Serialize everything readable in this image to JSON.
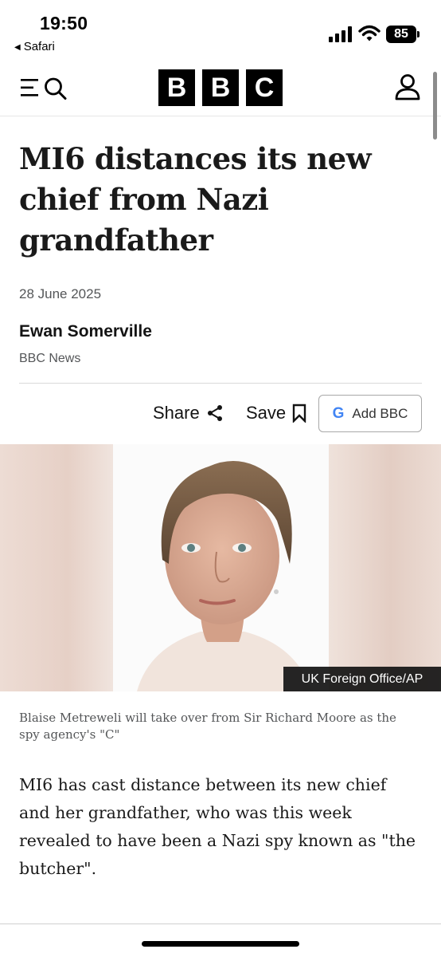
{
  "status_bar": {
    "time": "19:50",
    "back_app": "Safari",
    "battery": "85",
    "icons": [
      "cellular-signal-icon",
      "wifi-icon",
      "battery-icon"
    ]
  },
  "header": {
    "logo_letters": [
      "B",
      "B",
      "C"
    ],
    "icons": [
      "menu-icon",
      "search-icon",
      "account-icon"
    ]
  },
  "article": {
    "headline": "MI6 distances its new chief from Nazi grandfather",
    "date": "28 June 2025",
    "author": "Ewan Somerville",
    "publisher": "BBC News",
    "actions": {
      "share_label": "Share",
      "save_label": "Save",
      "add_label": "Add BBC"
    },
    "image": {
      "credit": "UK Foreign Office/AP",
      "caption": "Blaise Metreweli will take over from Sir Richard Moore as the spy agency's \"C\""
    },
    "body": "MI6 has cast distance between its new chief and her grandfather, who was this week revealed to have been a Nazi spy known as \"the butcher\"."
  },
  "colors": {
    "brand_black": "#000000",
    "text": "#141414",
    "meta_grey": "#545658"
  }
}
